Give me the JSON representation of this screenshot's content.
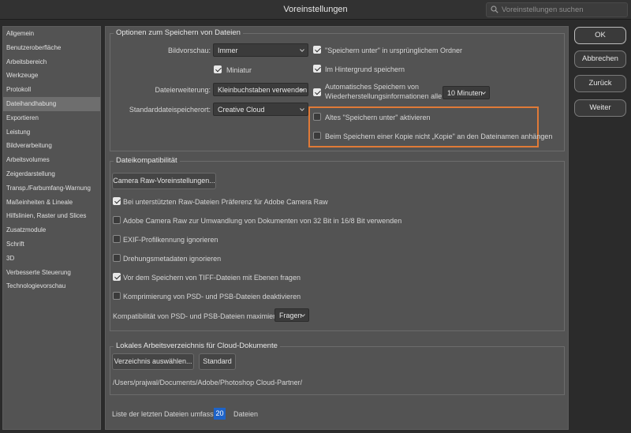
{
  "window": {
    "title": "Voreinstellungen"
  },
  "search": {
    "placeholder": "Voreinstellungen suchen",
    "icon": "search-icon"
  },
  "sidebar": {
    "items": [
      {
        "label": "Allgemein"
      },
      {
        "label": "Benutzeroberfläche"
      },
      {
        "label": "Arbeitsbereich"
      },
      {
        "label": "Werkzeuge"
      },
      {
        "label": "Protokoll"
      },
      {
        "label": "Dateihandhabung",
        "active": true
      },
      {
        "label": "Exportieren"
      },
      {
        "label": "Leistung"
      },
      {
        "label": "Bildverarbeitung"
      },
      {
        "label": "Arbeitsvolumes"
      },
      {
        "label": "Zeigerdarstellung"
      },
      {
        "label": "Transp./Farbumfang-Warnung"
      },
      {
        "label": "Maßeinheiten & Lineale"
      },
      {
        "label": "Hilfslinien, Raster und Slices"
      },
      {
        "label": "Zusatzmodule"
      },
      {
        "label": "Schrift"
      },
      {
        "label": "3D"
      },
      {
        "label": "Verbesserte Steuerung"
      },
      {
        "label": "Technologievorschau"
      }
    ]
  },
  "save_options": {
    "title": "Optionen zum Speichern von Dateien",
    "preview_label": "Bildvorschau:",
    "preview_value": "Immer",
    "thumbnail_label": "Miniatur",
    "thumbnail_checked": true,
    "extension_label": "Dateierweiterung:",
    "extension_value": "Kleinbuchstaben verwenden",
    "default_location_label": "Standarddateispeicherort:",
    "default_location_value": "Creative Cloud",
    "save_as_original_folder": {
      "label": "\"Speichern unter\" in ursprünglichem Ordner",
      "checked": true
    },
    "save_background": {
      "label": "Im Hintergrund speichern",
      "checked": true
    },
    "autosave": {
      "label_line1": "Automatisches Speichern von",
      "label_line2": "Wiederherstellungsinformationen alle:",
      "checked": true,
      "interval": "10 Minuten"
    },
    "legacy_save_as": {
      "label": "Altes \"Speichern unter\" aktivieren",
      "checked": false
    },
    "no_copy_suffix": {
      "label": "Beim Speichern einer Kopie nicht „Kopie\" an den Dateinamen anhängen",
      "checked": false
    }
  },
  "compat": {
    "title": "Dateikompatibilität",
    "camera_raw_button": "Camera Raw-Voreinstellungen...",
    "options": [
      {
        "label": "Bei unterstützten Raw-Dateien Präferenz für Adobe Camera Raw",
        "checked": true
      },
      {
        "label": "Adobe Camera Raw zur Umwandlung von Dokumenten von 32 Bit in 16/8 Bit verwenden",
        "checked": false
      },
      {
        "label": "EXIF-Profilkennung ignorieren",
        "checked": false
      },
      {
        "label": "Drehungsmetadaten ignorieren",
        "checked": false
      },
      {
        "label": "Vor dem Speichern von TIFF-Dateien mit Ebenen fragen",
        "checked": true
      },
      {
        "label": "Komprimierung von PSD- und PSB-Dateien deaktivieren",
        "checked": false
      }
    ],
    "maximize_label": "Kompatibilität von PSD- und PSB-Dateien maximieren:",
    "maximize_value": "Fragen"
  },
  "cloud": {
    "title": "Lokales Arbeitsverzeichnis für Cloud-Dokumente",
    "choose_button": "Verzeichnis auswählen...",
    "default_button": "Standard",
    "path": "/Users/prajwal/Documents/Adobe/Photoshop Cloud-Partner/"
  },
  "recent": {
    "label": "Liste der letzten Dateien umfasst:",
    "value": "20",
    "suffix": "Dateien"
  },
  "actions": {
    "ok": "OK",
    "cancel": "Abbrechen",
    "back": "Zurück",
    "next": "Weiter"
  },
  "colors": {
    "highlight": "#e07a37",
    "active_field": "#1e63c8",
    "panel": "#535353"
  }
}
